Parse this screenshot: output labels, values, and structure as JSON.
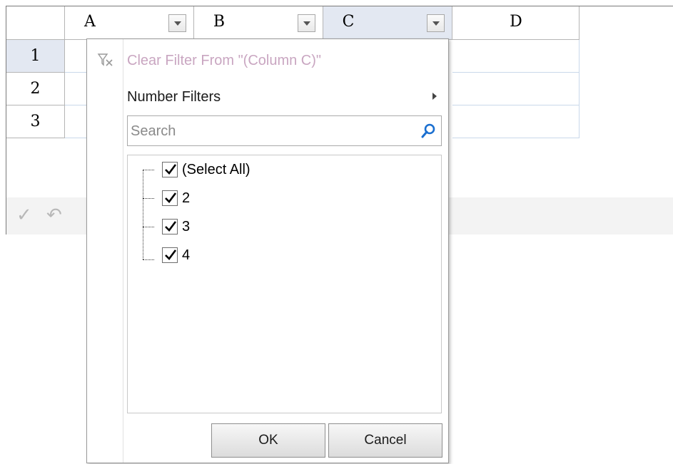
{
  "sheet": {
    "columns": [
      {
        "label": "A"
      },
      {
        "label": "B"
      },
      {
        "label": "C"
      },
      {
        "label": "D"
      }
    ],
    "rows": [
      {
        "label": "1"
      },
      {
        "label": "2"
      },
      {
        "label": "3"
      }
    ],
    "selected_column": "C",
    "selected_row": "1"
  },
  "formula_bar": {
    "icons": [
      "checkmark-icon",
      "undo-icon"
    ]
  },
  "filter_popup": {
    "clear_filter_label": "Clear Filter From \"(Column C)\"",
    "number_filters_label": "Number Filters",
    "search_placeholder": "Search",
    "items": [
      {
        "label": "(Select All)",
        "checked": true
      },
      {
        "label": "2",
        "checked": true
      },
      {
        "label": "3",
        "checked": true
      },
      {
        "label": "4",
        "checked": true
      }
    ],
    "ok_label": "OK",
    "cancel_label": "Cancel"
  },
  "colors": {
    "selected_header": "#e3e8f2",
    "disabled_text": "#c9a6c1",
    "search_icon": "#1a6fd0",
    "grid_line": "#c9d8ea"
  }
}
